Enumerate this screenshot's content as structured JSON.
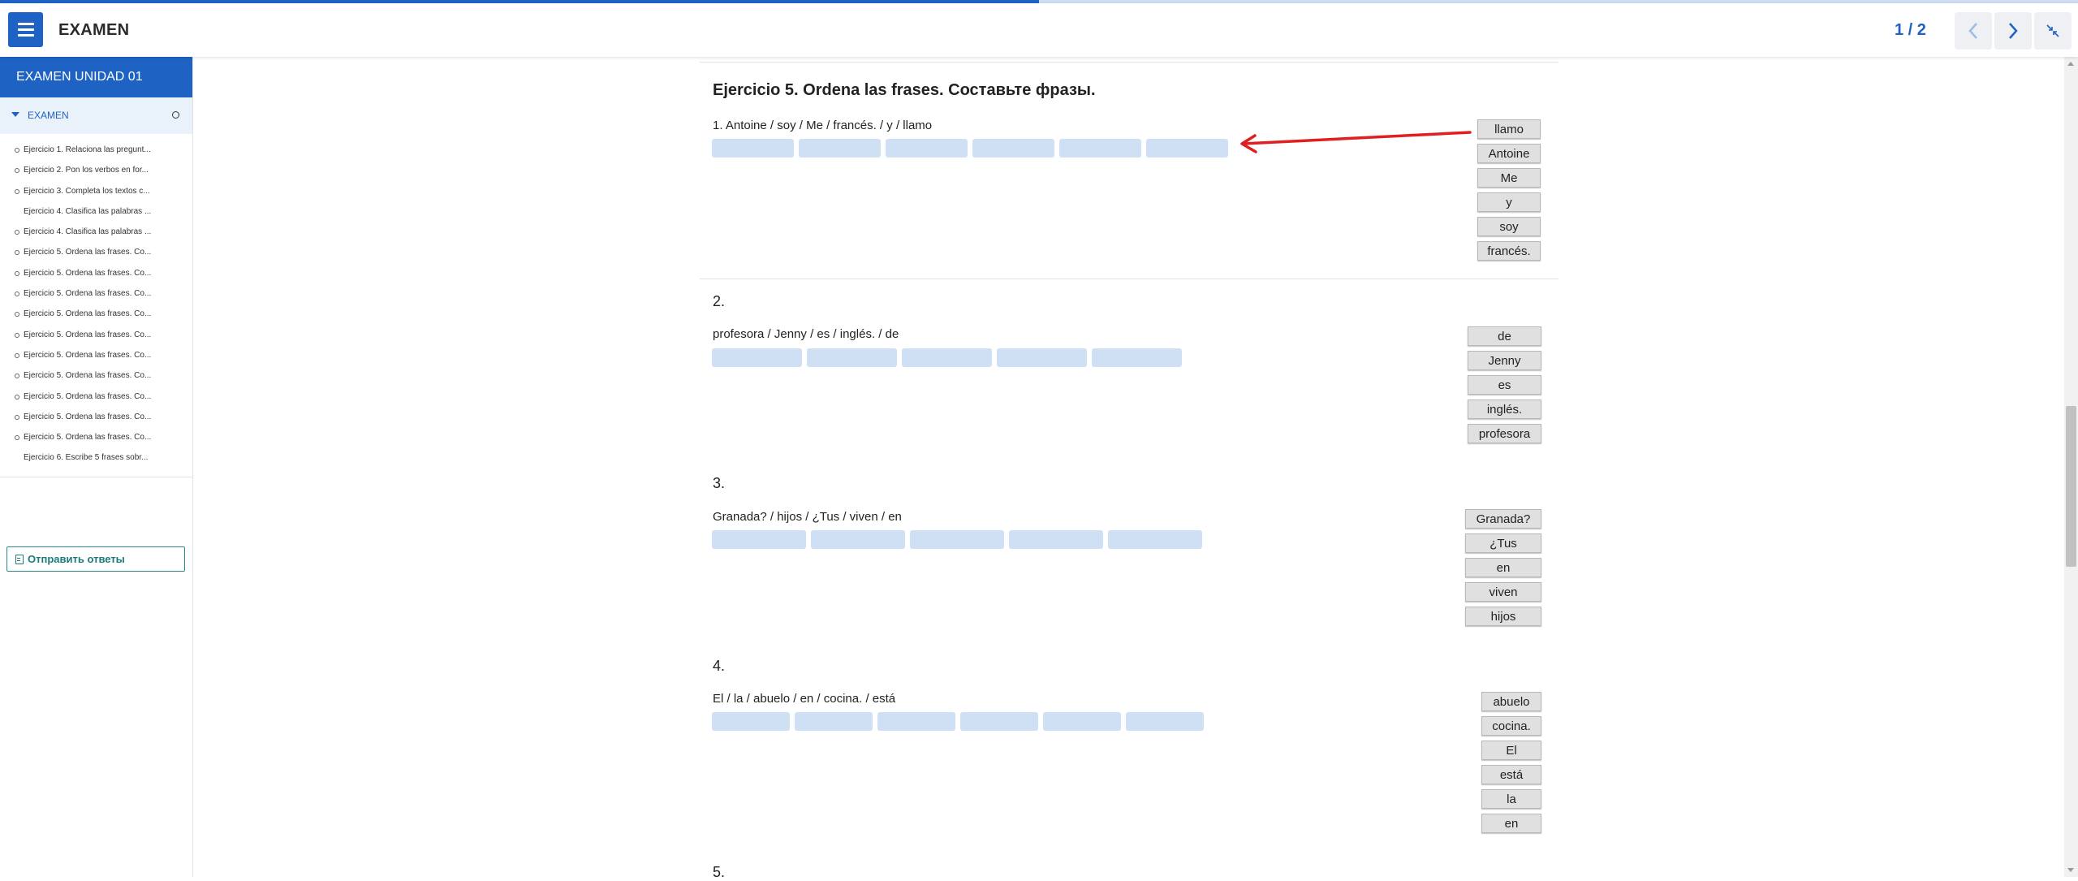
{
  "progress": {
    "fraction": 0.5
  },
  "header": {
    "title": "EXAMEN",
    "page_counter": "1 / 2"
  },
  "sidebar": {
    "title": "EXAMEN UNIDAD 01",
    "section": "EXAMEN",
    "items": [
      {
        "label": "Ejercicio 1. Relaciona las pregunt...",
        "dot": true
      },
      {
        "label": "Ejercicio 2. Pon los verbos en for...",
        "dot": true
      },
      {
        "label": "Ejercicio 3. Completa los textos c...",
        "dot": true
      },
      {
        "label": "Ejercicio 4. Clasifica las palabras ...",
        "dot": false
      },
      {
        "label": "Ejercicio 4. Clasifica las palabras ...",
        "dot": true
      },
      {
        "label": "Ejercicio 5. Ordena las frases. Co...",
        "dot": true
      },
      {
        "label": "Ejercicio 5. Ordena las frases. Co...",
        "dot": true
      },
      {
        "label": "Ejercicio 5. Ordena las frases. Co...",
        "dot": true
      },
      {
        "label": "Ejercicio 5. Ordena las frases. Co...",
        "dot": true
      },
      {
        "label": "Ejercicio 5. Ordena las frases. Co...",
        "dot": true
      },
      {
        "label": "Ejercicio 5. Ordena las frases. Co...",
        "dot": true
      },
      {
        "label": "Ejercicio 5. Ordena las frases. Co...",
        "dot": true
      },
      {
        "label": "Ejercicio 5. Ordena las frases. Co...",
        "dot": true
      },
      {
        "label": "Ejercicio 5. Ordena las frases. Co...",
        "dot": true
      },
      {
        "label": "Ejercicio 5. Ordena las frases. Co...",
        "dot": true
      },
      {
        "label": "Ejercicio 6. Escribe 5 frases sobr...",
        "dot": false
      }
    ],
    "submit_label": "Отправить ответы"
  },
  "exercise": {
    "title": "Ejercicio 5. Ordena las frases. Составьте фразы.",
    "questions": [
      {
        "number": "",
        "prompt": "1. Antoine / soy / Me / francés. / y / llamo",
        "slots": 6,
        "words": [
          "llamo",
          "Antoine",
          "Me",
          "y",
          "soy",
          "francés."
        ]
      },
      {
        "number": "2.",
        "prompt": "profesora / Jenny / es / inglés. / de",
        "slots": 5,
        "words": [
          "de",
          "Jenny",
          "es",
          "inglés.",
          "profesora"
        ]
      },
      {
        "number": "3.",
        "prompt": "Granada? / hijos / ¿Tus / viven / en",
        "slots": 5,
        "words": [
          "Granada?",
          "¿Tus",
          "en",
          "viven",
          "hijos"
        ]
      },
      {
        "number": "4.",
        "prompt": "El / la / abuelo / en / cocina. / está",
        "slots": 6,
        "words": [
          "abuelo",
          "cocina.",
          "El",
          "está",
          "la",
          "en"
        ]
      },
      {
        "number": "5.",
        "prompt": "",
        "slots": 0,
        "words": []
      }
    ]
  },
  "colors": {
    "accent": "#1e63c4",
    "slot": "#cfe0f5",
    "chip": "#e0e0e0",
    "annotation_arrow": "#e02020",
    "submit": "#1c7a7a"
  },
  "icons": {
    "menu": "hamburger-icon",
    "prev": "chevron-left-icon",
    "next": "chevron-right-icon",
    "collapse": "collapse-arrows-icon",
    "submit": "document-icon"
  }
}
